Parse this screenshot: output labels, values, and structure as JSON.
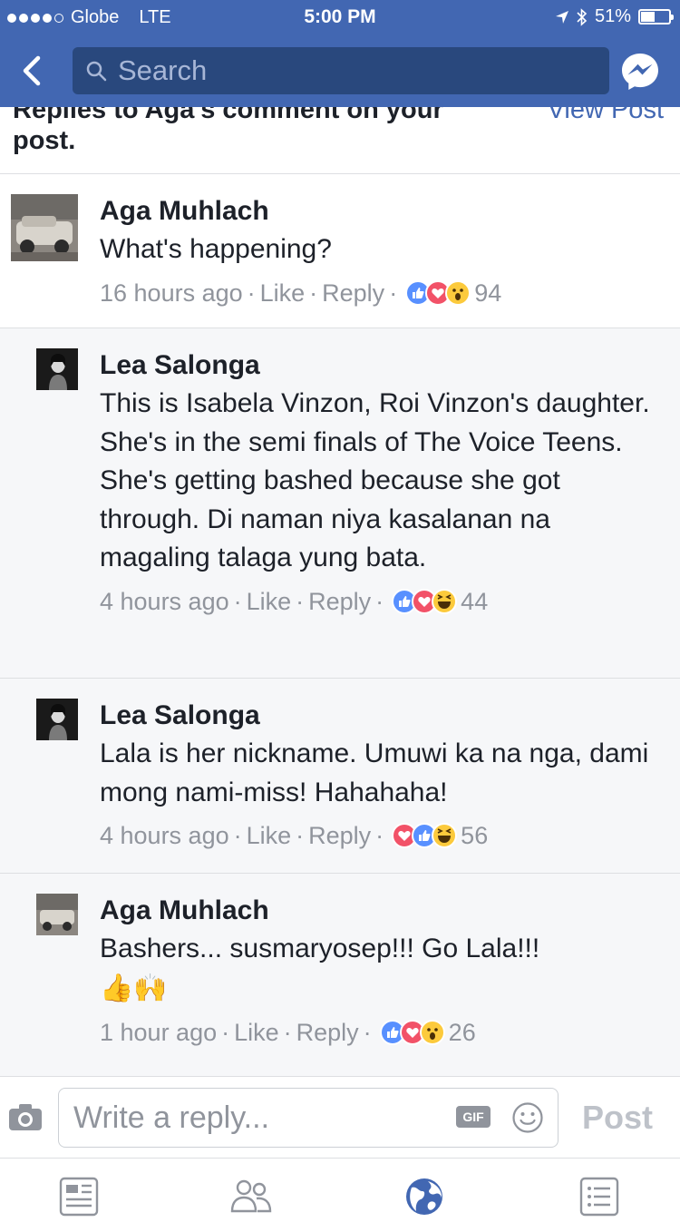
{
  "status_bar": {
    "carrier": "Globe",
    "network": "LTE",
    "time": "5:00 PM",
    "battery": "51%",
    "battery_level": 0.51
  },
  "header": {
    "search_placeholder": "Search",
    "back_icon": "chevron-left-icon",
    "messenger_icon": "messenger-icon",
    "background_color": "#4267b2"
  },
  "notice": {
    "title": "Replies to Aga's comment on your post.",
    "link": "View Post"
  },
  "comments": [
    {
      "author": "Aga Muhlach",
      "text": "What's happening?",
      "time": "16 hours ago",
      "like_label": "Like",
      "reply_label": "Reply",
      "reactions": [
        "like",
        "love",
        "wow"
      ],
      "count": "94"
    },
    {
      "author": "Lea Salonga",
      "text": "This is Isabela Vinzon, Roi Vinzon's daughter. She's in the semi finals of The Voice Teens. She's getting bashed because she got through. Di naman niya kasalanan na magaling talaga yung bata.",
      "time": "4 hours ago",
      "like_label": "Like",
      "reply_label": "Reply",
      "reactions": [
        "like",
        "love",
        "haha"
      ],
      "count": "44"
    },
    {
      "author": "Lea Salonga",
      "text": "Lala is her nickname. Umuwi ka na nga, dami mong nami-miss! Hahahaha!",
      "time": "4 hours ago",
      "like_label": "Like",
      "reply_label": "Reply",
      "reactions": [
        "love",
        "like",
        "haha"
      ],
      "count": "56"
    },
    {
      "author": "Aga Muhlach",
      "text": "Bashers... susmaryosep!!! Go Lala!!!",
      "emoji": "👍🙌",
      "time": "1 hour ago",
      "like_label": "Like",
      "reply_label": "Reply",
      "reactions": [
        "like",
        "love",
        "wow"
      ],
      "count": "26"
    }
  ],
  "composer": {
    "placeholder": "Write a reply...",
    "gif_label": "GIF",
    "post_label": "Post"
  },
  "tabs": [
    {
      "name": "news-feed",
      "icon": "news-feed-icon"
    },
    {
      "name": "friends",
      "icon": "friends-icon"
    },
    {
      "name": "globe",
      "icon": "notifications-globe-icon",
      "active": true
    },
    {
      "name": "menu",
      "icon": "menu-list-icon"
    }
  ]
}
